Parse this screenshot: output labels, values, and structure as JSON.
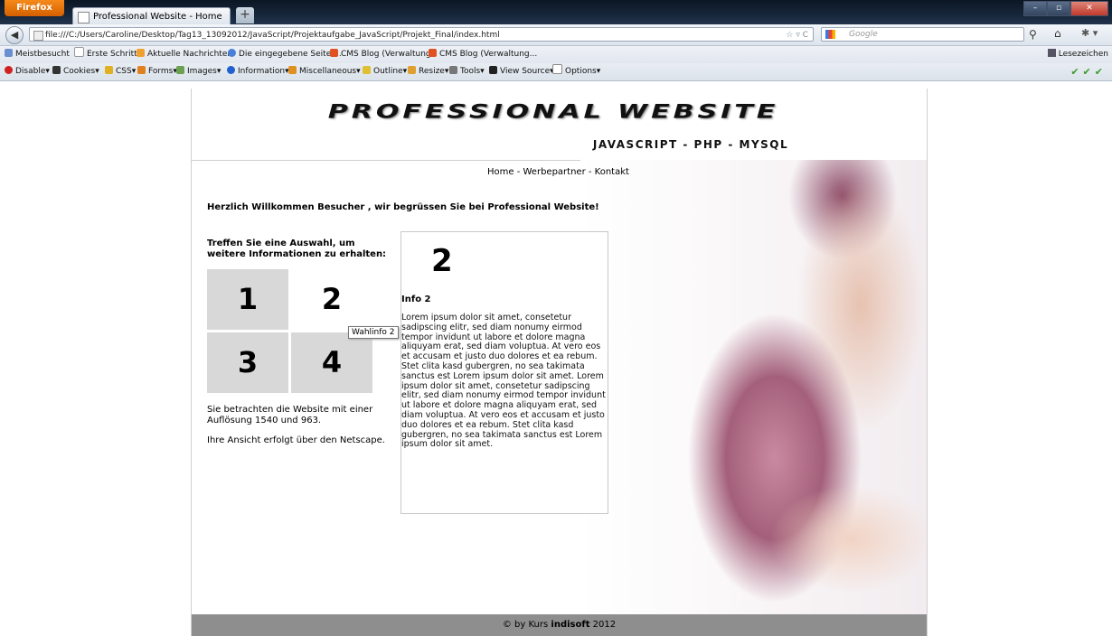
{
  "browser": {
    "app_button": "Firefox",
    "tab_title": "Professional Website - Home",
    "url": "file:///C:/Users/Caroline/Desktop/Tag13_13092012/JavaScript/Projektaufgabe_JavaScript/Projekt_Final/index.html",
    "search_placeholder": "Google",
    "bookmarks": [
      "Meistbesucht",
      "Erste Schritte",
      "Aktuelle Nachrichten",
      "Die eingegebene Seite ...",
      "CMS Blog (Verwaltung)",
      "CMS Blog (Verwaltung..."
    ],
    "bookmarks_right": "Lesezeichen",
    "devtools": [
      "Disable",
      "Cookies",
      "CSS",
      "Forms",
      "Images",
      "Information",
      "Miscellaneous",
      "Outline",
      "Resize",
      "Tools",
      "View Source",
      "Options"
    ],
    "checks": "✔✔✔"
  },
  "site": {
    "logo": "PROFESSIONAL WEBSITE",
    "slogan": "JAVASCRIPT - PHP - MYSQL",
    "nav": [
      "Home",
      "Werbepartner",
      "Kontakt"
    ],
    "nav_sep": " - ",
    "welcome": "Herzlich Willkommen Besucher , wir begrüssen Sie bei Professional Website!",
    "choose": "Treffen Sie eine Auswahl, um weitere Informationen zu erhalten:",
    "tiles": [
      "1",
      "2",
      "3",
      "4"
    ],
    "tooltip": "Wahlinfo 2",
    "resolution_text": "Sie betrachten die Website mit einer Auflösung 1540 und 963.",
    "browser_text": "Ihre Ansicht erfolgt über den Netscape.",
    "info": {
      "number": "2",
      "title": "Info 2",
      "text": "Lorem ipsum dolor sit amet, consetetur sadipscing elitr, sed diam nonumy eirmod tempor invidunt ut labore et dolore magna aliquyam erat, sed diam voluptua. At vero eos et accusam et justo duo dolores et ea rebum. Stet clita kasd gubergren, no sea takimata sanctus est Lorem ipsum dolor sit amet. Lorem ipsum dolor sit amet, consetetur sadipscing elitr, sed diam nonumy eirmod tempor invidunt ut labore et dolore magna aliquyam erat, sed diam voluptua. At vero eos et accusam et justo duo dolores et ea rebum. Stet clita kasd gubergren, no sea takimata sanctus est Lorem ipsum dolor sit amet."
    },
    "footer_prefix": "© by Kurs ",
    "footer_brand": "indisoft",
    "footer_suffix": " 2012"
  }
}
